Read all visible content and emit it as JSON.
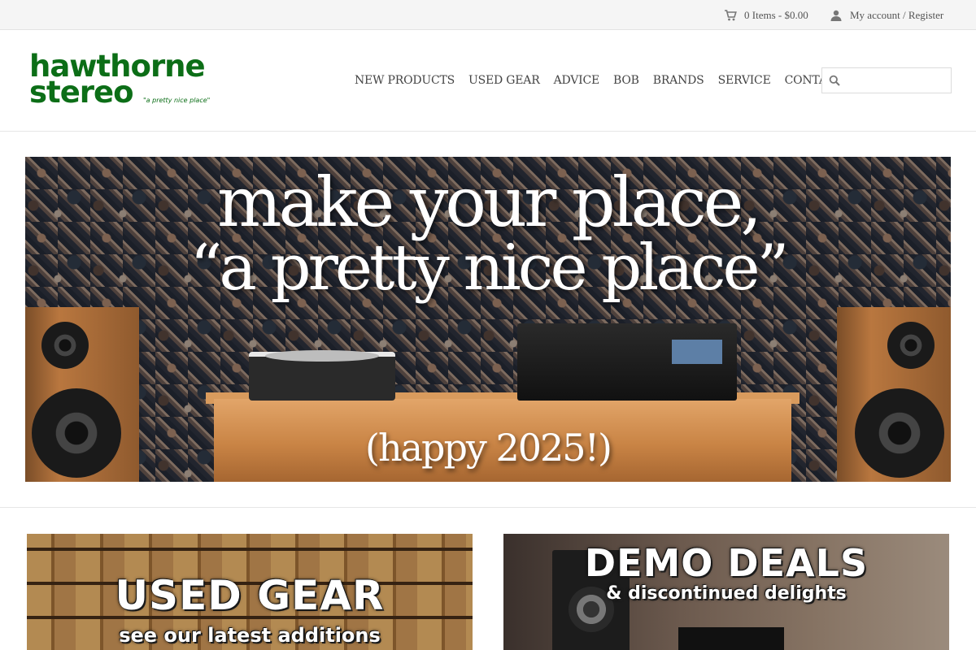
{
  "topbar": {
    "cart_label": "0 Items - $0.00",
    "account_label": "My account / Register"
  },
  "logo": {
    "line1": "hawthorne",
    "line2": "stereo",
    "tagline": "\"a pretty nice place\""
  },
  "nav": {
    "items": [
      "NEW PRODUCTS",
      "USED GEAR",
      "ADVICE",
      "BOB",
      "BRANDS",
      "SERVICE",
      "CONTACT"
    ]
  },
  "search": {
    "placeholder": ""
  },
  "hero": {
    "line1": "make your place,",
    "line2": "“a pretty nice place”",
    "line3": "(happy 2025!)"
  },
  "tiles": {
    "used_title": "USED GEAR",
    "used_subtitle": "see our latest additions",
    "demo_title": "DEMO DEALS",
    "demo_subtitle": "& discontinued delights"
  },
  "colors": {
    "brand_green": "#0c6e17",
    "topbar_bg": "#f5f5f5",
    "nav_text": "#444444"
  },
  "icons": [
    "cart-icon",
    "user-icon",
    "search-icon"
  ]
}
